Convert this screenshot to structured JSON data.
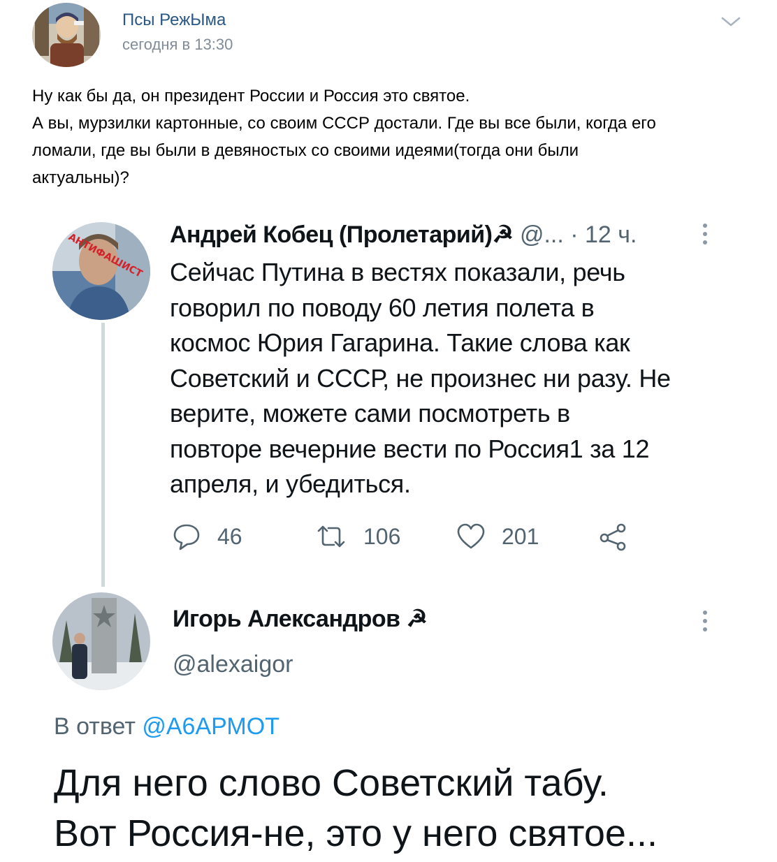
{
  "vk_post": {
    "author": "Псы РежЫма",
    "time": "сегодня в 13:30",
    "text_lines": [
      "Ну как бы да, он президент России и Россия это святое.",
      "А вы, мурзилки картонные, со своим СССР достали. Где вы все были, когда его",
      "ломали, где вы были в девяностых со своими идеями(тогда они были",
      "актуальны)?"
    ]
  },
  "tweet1": {
    "author": "Андрей Кобец (Пролетарий)☭",
    "handle": "@...",
    "time": "· 12 ч.",
    "avatar_text": "АНТИФАШИСТ",
    "text_lines": [
      "Сейчас Путина в вестях показали, речь",
      "говорил по поводу 60 летия полета в",
      "космос Юрия Гагарина. Такие слова как",
      "Советский и СССР, не произнес ни разу. Не",
      "верите, можете сами посмотреть в",
      "повторе вечерние вести по Россия1 за 12",
      "апреля, и убедиться."
    ],
    "replies": "46",
    "retweets": "106",
    "likes": "201"
  },
  "tweet2": {
    "author": "Игорь Александров ☭",
    "handle": "@alexaigor",
    "reply_prefix": "В ответ ",
    "reply_to": "@А6АРМОТ",
    "text_lines": [
      "Для него слово Советский табу.",
      "Вот Россия-не, это у него святое..."
    ]
  },
  "colors": {
    "vk_link": "#2a5885",
    "vk_meta": "#818c99",
    "twitter_blue": "#1d9bf0",
    "twitter_gray": "#536471"
  },
  "icons": [
    "chevron-down-icon",
    "reply-icon",
    "retweet-icon",
    "like-icon",
    "share-icon",
    "more-icon"
  ]
}
